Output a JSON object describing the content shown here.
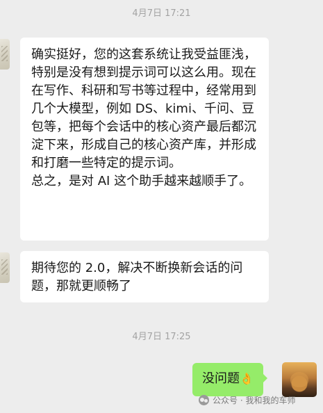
{
  "chat": {
    "timestamps": [
      "4月7日 17:21",
      "4月7日 17:25"
    ],
    "messages": [
      {
        "side": "left",
        "paragraphs": [
          "确实挺好，您的这套系统让我受益匪浅，特别是没有想到提示词可以这么用。现在在写作、科研和写书等过程中，经常用到几个大模型，例如 DS、kimi、千问、豆包等，把每个会话中的核心资产最后都沉淀下来，形成自己的核心资产库，并形成和打磨一些特定的提示词。",
          "总之，是对 AI 这个助手越来越顺手了。"
        ]
      },
      {
        "side": "left",
        "paragraphs": [
          "期待您的 2.0，解决不断换新会话的问题，那就更顺畅了"
        ]
      },
      {
        "side": "right",
        "text": "没问题",
        "emoji": "👌"
      }
    ]
  },
  "watermark": {
    "text": "公众号 · 我和我的车师"
  },
  "colors": {
    "background": "#ededed",
    "bubble_in": "#ffffff",
    "bubble_out": "#95ec69",
    "timestamp": "#a3a3a3"
  }
}
